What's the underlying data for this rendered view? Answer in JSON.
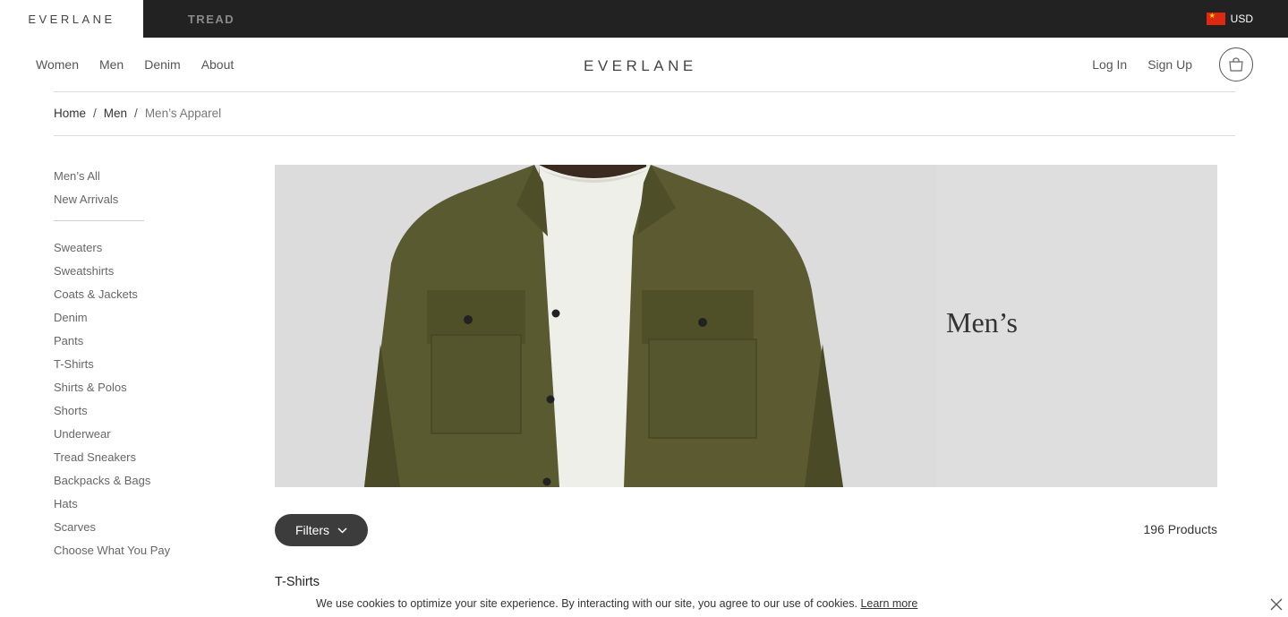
{
  "topbar": {
    "brands": [
      "EVERLANE",
      "TREAD"
    ],
    "currency": "USD",
    "flag_icon": "china-flag-icon"
  },
  "header": {
    "nav_left": [
      "Women",
      "Men",
      "Denim",
      "About"
    ],
    "logo": "EVERLANE",
    "login": "Log In",
    "signup": "Sign Up",
    "cart_icon": "bag-icon"
  },
  "breadcrumb": {
    "home": "Home",
    "men": "Men",
    "current": "Men’s Apparel",
    "separator": "/"
  },
  "sidebar": {
    "top_items": [
      "Men’s All",
      "New Arrivals"
    ],
    "categories": [
      "Sweaters",
      "Sweatshirts",
      "Coats & Jackets",
      "Denim",
      "Pants",
      "T-Shirts",
      "Shirts & Polos",
      "Shorts",
      "Underwear",
      "Tread Sneakers",
      "Backpacks & Bags",
      "Hats",
      "Scarves",
      "Choose What You Pay"
    ]
  },
  "hero": {
    "title": "Men’s",
    "image": "man-in-olive-flannel-shirt-over-white-thermal"
  },
  "listing": {
    "filters_label": "Filters",
    "product_count": "196 Products",
    "section_title": "T-Shirts"
  },
  "cookie": {
    "text": "We use cookies to optimize your site experience. By interacting with our site, you agree to our use of cookies.",
    "link": "Learn more",
    "close_icon": "close-icon"
  },
  "colors": {
    "topbar_bg": "#222222",
    "filters_bg": "#3c3c3c",
    "hero_bg": "#dcdcdc",
    "shirt": "#5a5a30"
  }
}
